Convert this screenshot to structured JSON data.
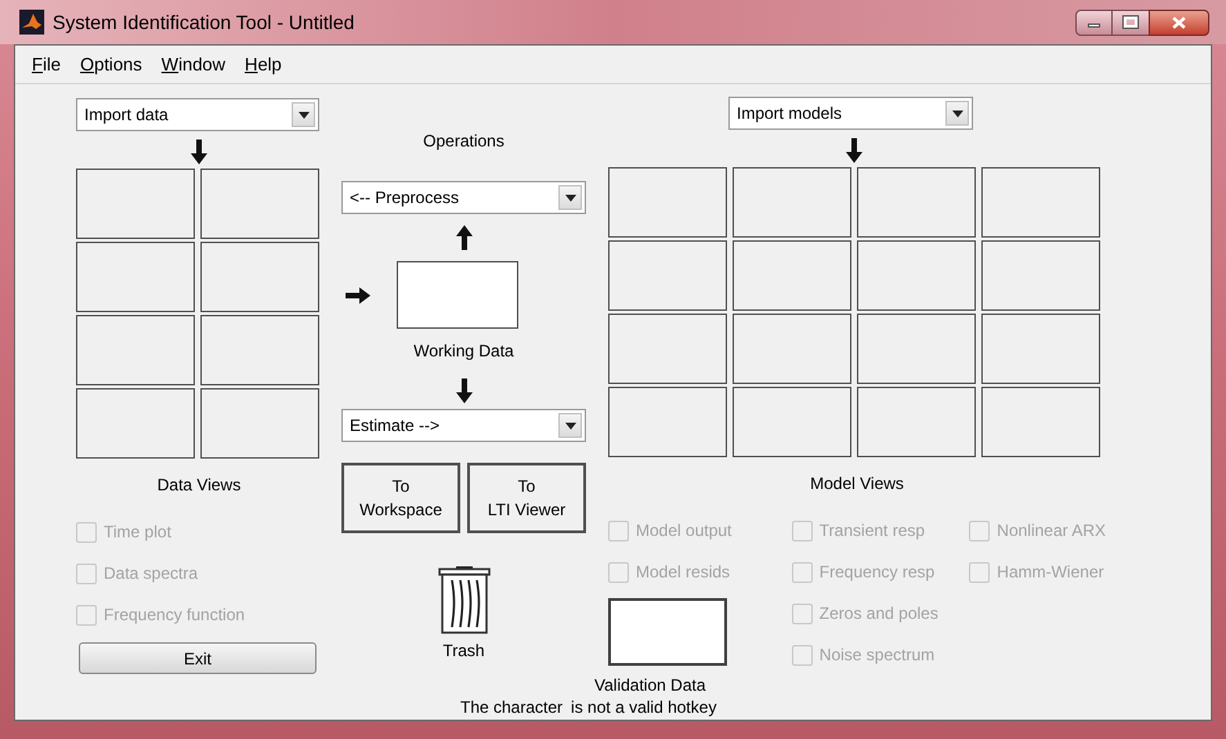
{
  "window": {
    "title": "System Identification Tool - Untitled"
  },
  "menu": [
    {
      "label": "File"
    },
    {
      "label": "Options"
    },
    {
      "label": "Window"
    },
    {
      "label": "Help"
    }
  ],
  "data_import": {
    "value": "Import data"
  },
  "operations": {
    "title": "Operations",
    "preprocess": "<-- Preprocess",
    "working_data": "Working Data",
    "estimate": "Estimate -->",
    "buttons": [
      "To\nWorkspace",
      "To\nLTI Viewer"
    ]
  },
  "data_views": {
    "title": "Data Views",
    "options": [
      {
        "label": "Time plot",
        "checked": false,
        "disabled": true
      },
      {
        "label": "Data spectra",
        "checked": false,
        "disabled": true
      },
      {
        "label": "Frequency function",
        "checked": false,
        "disabled": true
      }
    ]
  },
  "exit": "Exit",
  "trash": "Trash",
  "model_import": {
    "value": "Import models"
  },
  "model_views": {
    "title": "Model Views",
    "columns": [
      [
        {
          "label": "Model output",
          "checked": false,
          "disabled": true
        },
        {
          "label": "Model resids",
          "checked": false,
          "disabled": true
        }
      ],
      [
        {
          "label": "Transient resp",
          "checked": false,
          "disabled": true
        },
        {
          "label": "Frequency resp",
          "checked": false,
          "disabled": true
        },
        {
          "label": "Zeros and poles",
          "checked": false,
          "disabled": true
        },
        {
          "label": "Noise spectrum",
          "checked": false,
          "disabled": true
        }
      ],
      [
        {
          "label": "Nonlinear ARX",
          "checked": false,
          "disabled": true
        },
        {
          "label": "Hamm-Wiener",
          "checked": false,
          "disabled": true
        }
      ]
    ]
  },
  "validation": "Validation Data",
  "status": [
    "The character",
    "is not a valid hotkey"
  ]
}
